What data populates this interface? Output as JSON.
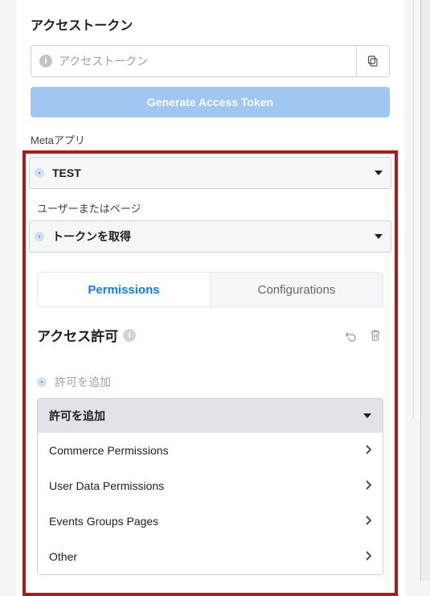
{
  "access_token": {
    "title": "アクセストークン",
    "placeholder": "アクセストークン",
    "generate_label": "Generate Access Token"
  },
  "meta_app": {
    "label": "Metaアプリ",
    "selected": "TEST"
  },
  "user_page": {
    "label": "ユーザーまたはページ",
    "selected": "トークンを取得"
  },
  "tabs": {
    "permissions": "Permissions",
    "configurations": "Configurations"
  },
  "permissions": {
    "title": "アクセス許可",
    "add_hint": "許可を追加",
    "dropdown_label": "許可を追加",
    "categories": [
      "Commerce Permissions",
      "User Data Permissions",
      "Events Groups Pages",
      "Other"
    ]
  }
}
